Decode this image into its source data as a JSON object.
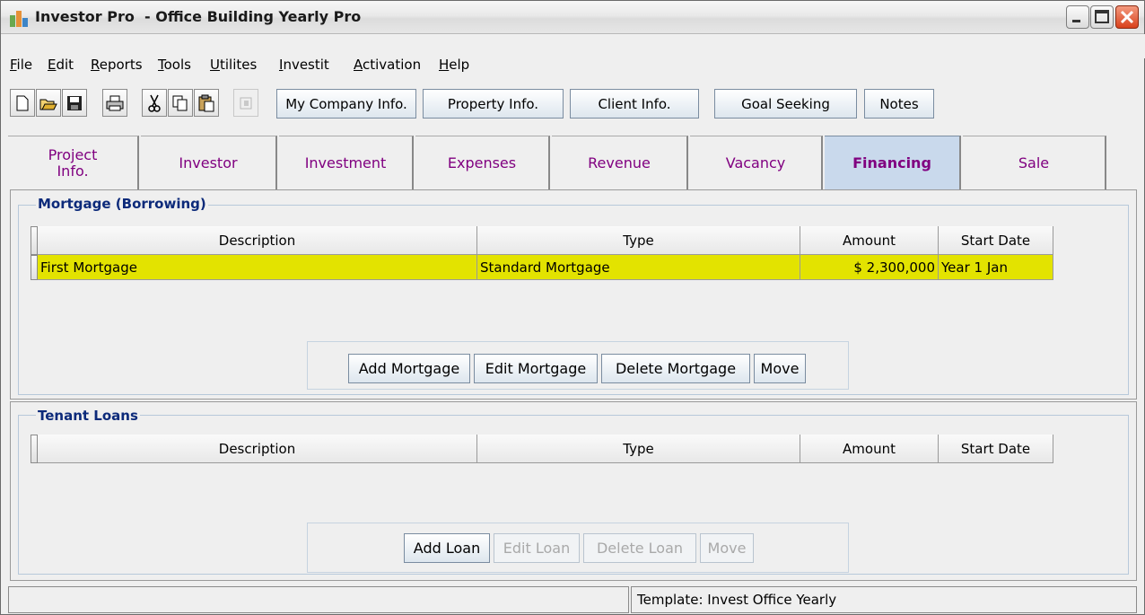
{
  "window": {
    "title": "Investor Pro  - Office Building Yearly Pro"
  },
  "menu": [
    {
      "label": "File",
      "u": "F",
      "rest": "ile"
    },
    {
      "label": "Edit",
      "u": "E",
      "rest": "dit"
    },
    {
      "label": "Reports",
      "u": "R",
      "rest": "eports"
    },
    {
      "label": "Tools",
      "u": "T",
      "rest": "ools"
    },
    {
      "label": "Utilites",
      "u": "U",
      "rest": "tilites"
    },
    {
      "label": "Investit",
      "u": "I",
      "rest": "nvestit"
    },
    {
      "label": "Activation",
      "u": "A",
      "rest": "ctivation"
    },
    {
      "label": "Help",
      "u": "H",
      "rest": "elp"
    }
  ],
  "toolbar": {
    "icons": [
      "new-file-icon",
      "open-folder-icon",
      "save-icon",
      "print-icon",
      "cut-icon",
      "copy-icon",
      "paste-icon",
      "exit-icon"
    ],
    "my_company": "My Company Info.",
    "property": "Property Info.",
    "client": "Client Info.",
    "goal_seeking": "Goal Seeking",
    "notes": "Notes"
  },
  "tabs": [
    {
      "label_1": "Project",
      "label_2": "Info."
    },
    {
      "label": "Investor"
    },
    {
      "label": "Investment"
    },
    {
      "label": "Expenses"
    },
    {
      "label": "Revenue"
    },
    {
      "label": "Vacancy"
    },
    {
      "label": "Financing"
    },
    {
      "label": "Sale"
    }
  ],
  "mortgage": {
    "title": "Mortgage (Borrowing)",
    "columns": [
      "Description",
      "Type",
      "Amount",
      "Start Date"
    ],
    "rows": [
      {
        "description": "First Mortgage",
        "type": "Standard Mortgage",
        "amount": "$ 2,300,000",
        "start": "Year 1 Jan"
      }
    ],
    "buttons": {
      "add": "Add Mortgage",
      "edit": "Edit Mortgage",
      "delete": "Delete Mortgage",
      "move": "Move"
    }
  },
  "tenant_loans": {
    "title": "Tenant Loans",
    "columns": [
      "Description",
      "Type",
      "Amount",
      "Start Date"
    ],
    "buttons": {
      "add": "Add Loan",
      "edit": "Edit Loan",
      "delete": "Delete Loan",
      "move": "Move"
    }
  },
  "status": {
    "template": "Template: Invest Office Yearly"
  },
  "colors": {
    "selected_row": "#e3e300",
    "group_title": "#0c2a7a",
    "tab_text": "#800080",
    "active_tab": "#c9d9ec"
  }
}
